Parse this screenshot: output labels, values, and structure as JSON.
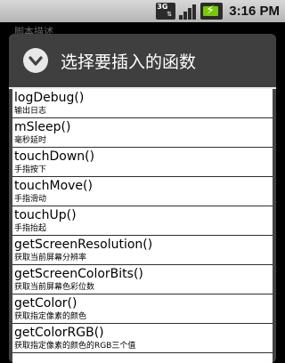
{
  "status_bar": {
    "network": "3G",
    "time": "3:16 PM"
  },
  "background": {
    "text": "脚本描述"
  },
  "dialog": {
    "title": "选择要插入的函数",
    "items": [
      {
        "name": "logDebug()",
        "desc": "输出日志"
      },
      {
        "name": "mSleep()",
        "desc": "毫秒延时"
      },
      {
        "name": "touchDown()",
        "desc": "手指按下"
      },
      {
        "name": "touchMove()",
        "desc": "手指滑动"
      },
      {
        "name": "touchUp()",
        "desc": "手指抬起"
      },
      {
        "name": "getScreenResolution()",
        "desc": "获取当前屏幕分辨率"
      },
      {
        "name": "getScreenColorBits()",
        "desc": "获取当前屏幕色彩位数"
      },
      {
        "name": "getColor()",
        "desc": "获取指定像素的颜色"
      },
      {
        "name": "getColorRGB()",
        "desc": "获取指定像素的颜色的RGB三个值"
      }
    ]
  }
}
